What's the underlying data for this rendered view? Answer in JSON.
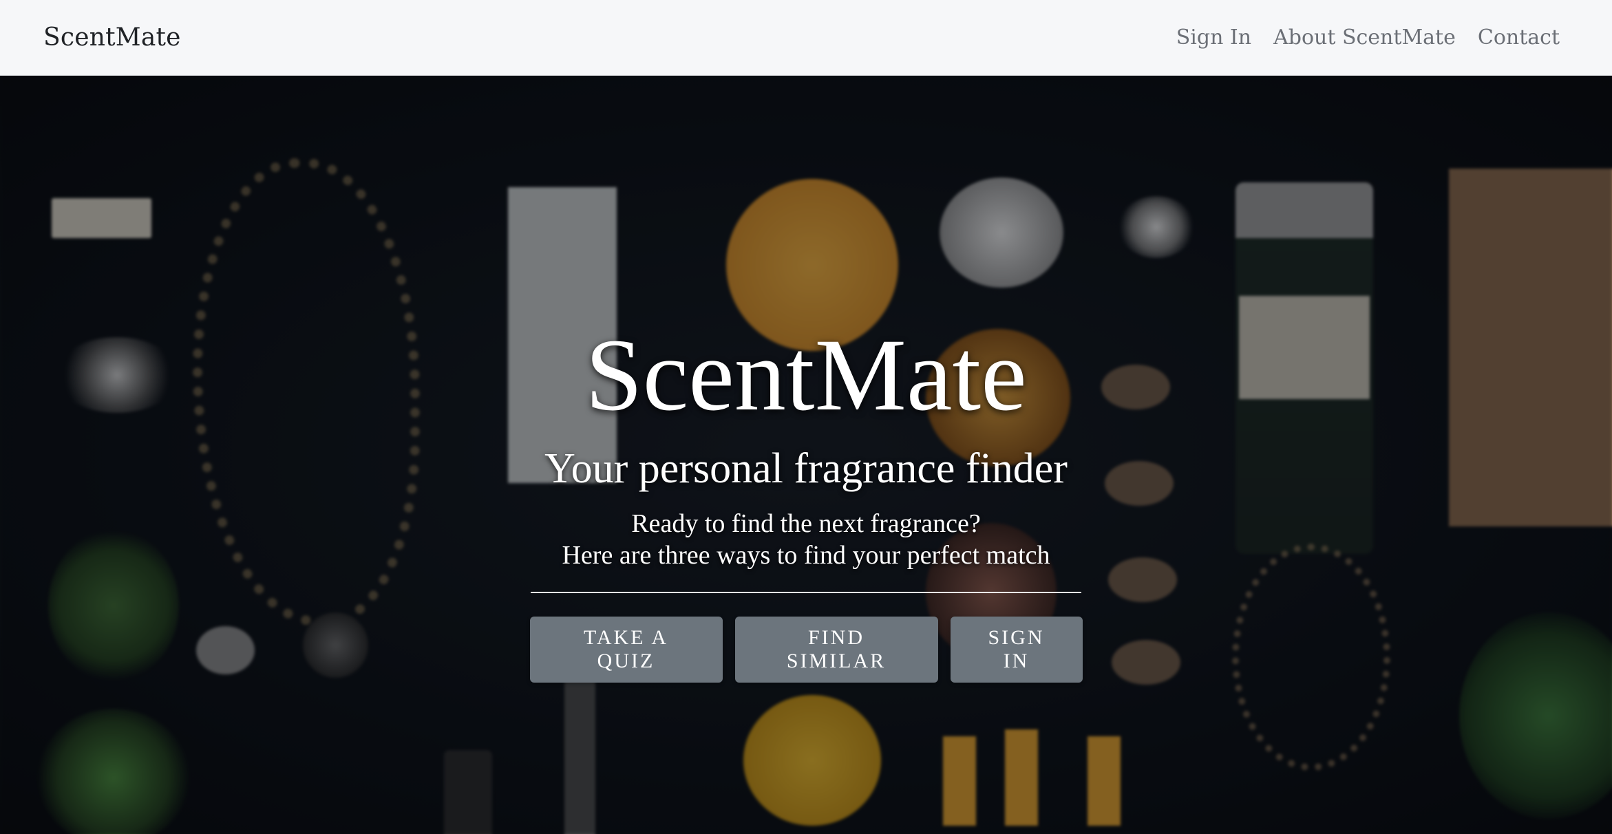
{
  "navbar": {
    "brand": "ScentMate",
    "links": [
      {
        "label": "Sign In"
      },
      {
        "label": "About ScentMate"
      },
      {
        "label": "Contact"
      }
    ]
  },
  "hero": {
    "title": "ScentMate",
    "subtitle": "Your personal fragrance finder",
    "line1": "Ready to find the next fragrance?",
    "line2": "Here are three ways to find your perfect match",
    "buttons": [
      {
        "label": "Take a Quiz"
      },
      {
        "label": "Find Similar"
      },
      {
        "label": "Sign In"
      }
    ]
  },
  "colors": {
    "navbar_bg": "#f6f7f9",
    "hero_bg": "#0b0f14",
    "button_bg": "#6c757d",
    "text_light": "#ffffff"
  }
}
